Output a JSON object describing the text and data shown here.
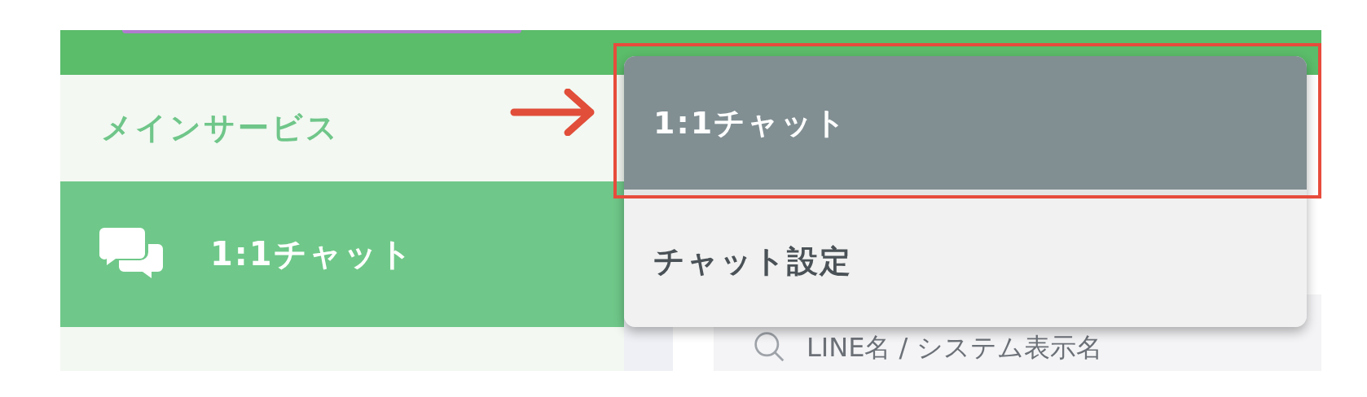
{
  "sidebar": {
    "section_title": "メインサービス",
    "items": [
      {
        "label": "1:1チャット",
        "selected": true
      }
    ]
  },
  "menu": {
    "items": [
      {
        "label": "1:1チャット",
        "selected": true
      },
      {
        "label": "チャット設定",
        "selected": false
      }
    ]
  },
  "search": {
    "placeholder": "LINE名 / システム表示名"
  }
}
